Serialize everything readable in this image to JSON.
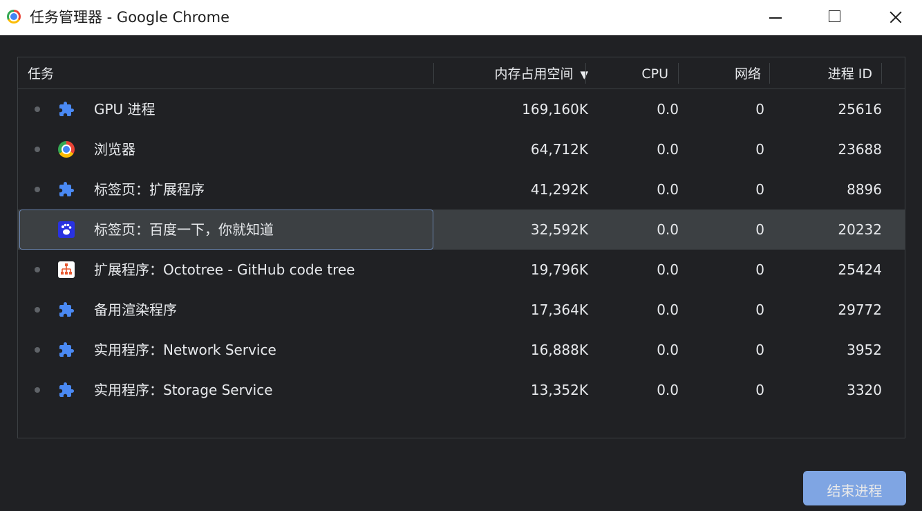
{
  "window": {
    "title": "任务管理器 - Google Chrome"
  },
  "table": {
    "headers": {
      "task": "任务",
      "memory": "内存占用空间",
      "sort_indicator": "▼",
      "cpu": "CPU",
      "network": "网络",
      "pid": "进程 ID"
    },
    "rows": [
      {
        "icon": "puzzle-icon",
        "task": "GPU 进程",
        "memory": "169,160K",
        "cpu": "0.0",
        "network": "0",
        "pid": "25616",
        "selected": false
      },
      {
        "icon": "chrome-icon",
        "task": "浏览器",
        "memory": "64,712K",
        "cpu": "0.0",
        "network": "0",
        "pid": "23688",
        "selected": false
      },
      {
        "icon": "puzzle-icon",
        "task": "标签页：扩展程序",
        "memory": "41,292K",
        "cpu": "0.0",
        "network": "0",
        "pid": "8896",
        "selected": false
      },
      {
        "icon": "baidu-icon",
        "task": "标签页：百度一下，你就知道",
        "memory": "32,592K",
        "cpu": "0.0",
        "network": "0",
        "pid": "20232",
        "selected": true
      },
      {
        "icon": "octotree-icon",
        "task": "扩展程序：Octotree - GitHub code tree",
        "memory": "19,796K",
        "cpu": "0.0",
        "network": "0",
        "pid": "25424",
        "selected": false
      },
      {
        "icon": "puzzle-icon",
        "task": "备用渲染程序",
        "memory": "17,364K",
        "cpu": "0.0",
        "network": "0",
        "pid": "29772",
        "selected": false
      },
      {
        "icon": "puzzle-icon",
        "task": "实用程序：Network Service",
        "memory": "16,888K",
        "cpu": "0.0",
        "network": "0",
        "pid": "3952",
        "selected": false
      },
      {
        "icon": "puzzle-icon",
        "task": "实用程序：Storage Service",
        "memory": "13,352K",
        "cpu": "0.0",
        "network": "0",
        "pid": "3320",
        "selected": false
      }
    ]
  },
  "footer": {
    "end_process_label": "结束进程"
  },
  "colors": {
    "background": "#202124",
    "accent": "#8ab4f8",
    "puzzle_blue": "#4a89f3"
  }
}
